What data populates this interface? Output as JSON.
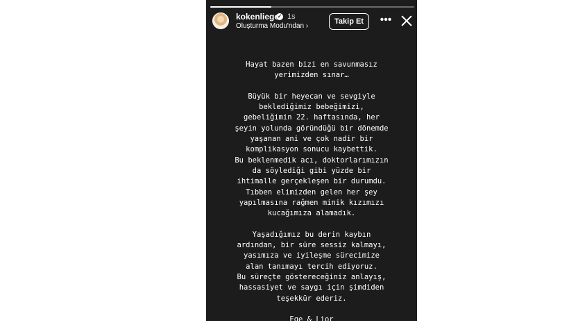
{
  "story": {
    "progress_fraction": 0.3,
    "username": "kokenliege",
    "time": "1s",
    "subtitle": "Oluşturma Modu'ndan ›",
    "follow_label": "Takip Et",
    "more_label": "•••",
    "paragraph1": "Hayat bazen bizi en savunmasız\nyerimizden sınar…",
    "paragraph2": "Büyük bir heyecan ve sevgiyle\nbeklediğimiz bebeğimizi,\ngebeliğimin 22. haftasında, her\nşeyin yolunda göründüğü bir dönemde\nyaşanan ani ve çok nadir bir\nkomplikasyon sonucu kaybettik.\nBu beklenmedik acı, doktorlarımızın\nda söylediği gibi yüzde bir\nihtimalle gerçekleşen bir durumdu.\nTıbben elimizden gelen her şey\nyapılmasına rağmen minik kızımızı\nkucağımıza alamadık.",
    "paragraph3": "Yaşadığımız bu derin kaybın\nardından, bir süre sessiz kalmayı,\nyasımıza ve iyileşme sürecimize\nalan tanımayı tercih ediyoruz.\nBu süreçte göstereceğiniz anlayış,\nhassasiyet ve saygı için şimdiden\nteşekkür ederiz.",
    "signature": "Ege & Lior"
  }
}
